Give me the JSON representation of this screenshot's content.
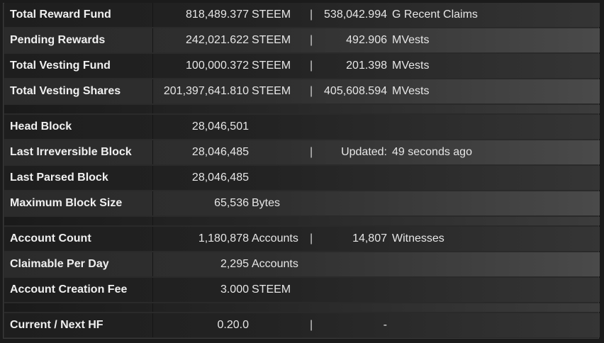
{
  "rows": [
    {
      "label": "Total Reward Fund",
      "value": "818,489.377",
      "unit": "STEEM",
      "pipe": "|",
      "value2": "538,042.994",
      "unit2": "G  Recent Claims"
    },
    {
      "label": "Pending Rewards",
      "value": "242,021.622",
      "unit": "STEEM",
      "pipe": "|",
      "value2": "492.906",
      "unit2": "MVests"
    },
    {
      "label": "Total Vesting Fund",
      "value": "100,000.372",
      "unit": "STEEM",
      "pipe": "|",
      "value2": "201.398",
      "unit2": "MVests"
    },
    {
      "label": "Total Vesting Shares",
      "value": "201,397,641.810",
      "unit": "STEEM",
      "pipe": "|",
      "value2": "405,608.594",
      "unit2": "MVests"
    },
    {
      "label": "Head Block",
      "value": "28,046,501"
    },
    {
      "label": "Last Irreversible Block",
      "value": "28,046,485",
      "pipe": "|",
      "value2": "Updated:",
      "unit2": "49 seconds ago"
    },
    {
      "label": "Last Parsed Block",
      "value": "28,046,485"
    },
    {
      "label": "Maximum Block Size",
      "value": "65,536",
      "unit": "Bytes"
    },
    {
      "label": "Account Count",
      "value": "1,180,878",
      "unit": "Accounts",
      "pipe": "|",
      "value2": "14,807",
      "unit2": "Witnesses"
    },
    {
      "label": "Claimable Per Day",
      "value": "2,295",
      "unit": "Accounts"
    },
    {
      "label": "Account Creation Fee",
      "value": "3.000",
      "unit": "STEEM"
    },
    {
      "label": "Current / Next HF",
      "value": "0.20.0",
      "pipe": "|",
      "value2": "-"
    }
  ]
}
